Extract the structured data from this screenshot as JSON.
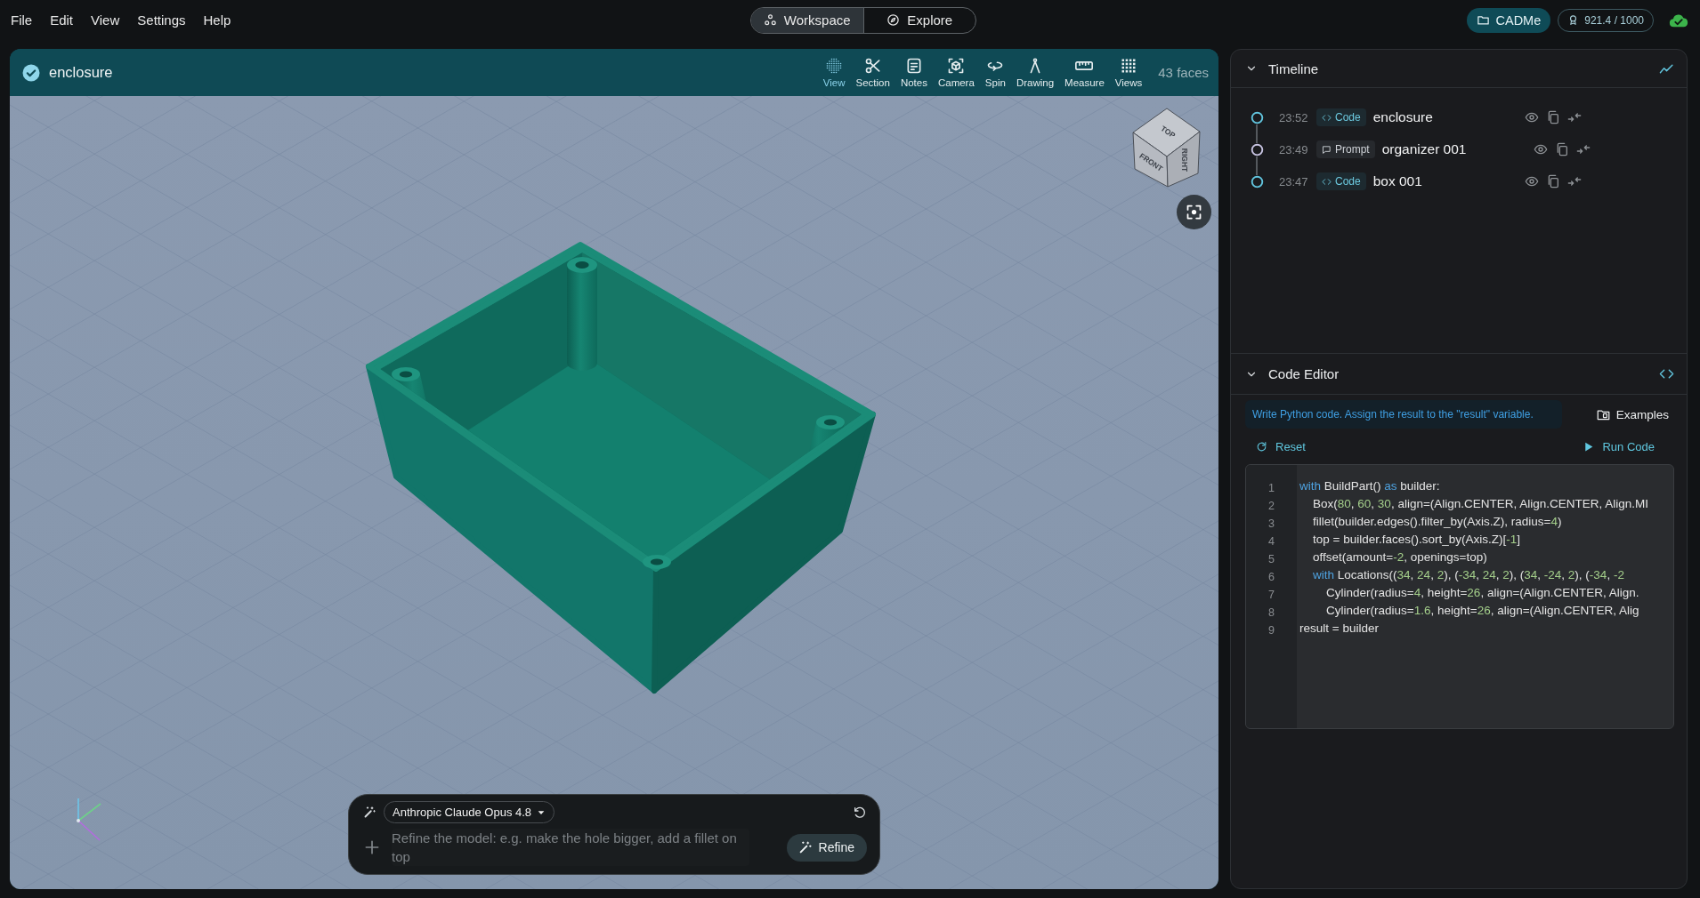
{
  "menu_bar": {
    "items": [
      "File",
      "Edit",
      "View",
      "Settings",
      "Help"
    ]
  },
  "mode_switch": [
    {
      "label": "Workspace",
      "kind": "workspace",
      "selected": true
    },
    {
      "label": "Explore",
      "kind": "explore",
      "selected": false
    }
  ],
  "account": {
    "project_button": "CADMe",
    "credits": "921.4 / 1000",
    "synced": true
  },
  "viewport": {
    "title": "enclosure",
    "tools": [
      {
        "label": "View",
        "kind": "view",
        "selected": true
      },
      {
        "label": "Section",
        "kind": "section",
        "selected": false
      },
      {
        "label": "Notes",
        "kind": "notes",
        "selected": false
      },
      {
        "label": "Camera",
        "kind": "camera",
        "selected": false
      },
      {
        "label": "Spin",
        "kind": "spin",
        "selected": false
      },
      {
        "label": "Drawing",
        "kind": "drawing",
        "selected": false
      },
      {
        "label": "Measure",
        "kind": "measure",
        "selected": false
      },
      {
        "label": "Views",
        "kind": "views",
        "selected": false
      }
    ],
    "face_count": "43 faces",
    "view_cube": [
      {
        "label": "TOP",
        "kind": "top"
      },
      {
        "label": "FRONT",
        "kind": "front"
      },
      {
        "label": "RIGHT",
        "kind": "right"
      }
    ]
  },
  "prompt": {
    "model": "Anthropic Claude Opus 4.8",
    "placeholder": "Refine the model: e.g. make the hole bigger, add a fillet on top",
    "button": "Refine"
  },
  "timeline": {
    "title": "Timeline",
    "expanded": true,
    "items": [
      {
        "time": "23:52",
        "kind": "code",
        "badge": "Code",
        "name": "enclosure"
      },
      {
        "time": "23:49",
        "kind": "prompt",
        "badge": "Prompt",
        "name": "organizer 001"
      },
      {
        "time": "23:47",
        "kind": "code",
        "badge": "Code",
        "name": "box 001"
      }
    ]
  },
  "code_editor": {
    "title": "Code Editor",
    "expanded": true,
    "hint": "Write Python code. Assign the result to the \"result\" variable.",
    "examples_button": "Examples",
    "reset_button": "Reset",
    "run_button": "Run Code",
    "lines": [
      {
        "number": "1",
        "tokens": [
          {
            "text": "with",
            "kind": "keyword"
          },
          {
            "text": " BuildPart() ",
            "kind": "plain"
          },
          {
            "text": "as",
            "kind": "keyword"
          },
          {
            "text": " builder:",
            "kind": "plain"
          }
        ]
      },
      {
        "number": "2",
        "tokens": [
          {
            "text": "    Box(",
            "kind": "plain"
          },
          {
            "text": "80",
            "kind": "number"
          },
          {
            "text": ", ",
            "kind": "plain"
          },
          {
            "text": "60",
            "kind": "number"
          },
          {
            "text": ", ",
            "kind": "plain"
          },
          {
            "text": "30",
            "kind": "number"
          },
          {
            "text": ", align=(Align.CENTER, Align.CENTER, Align.MI",
            "kind": "plain"
          }
        ]
      },
      {
        "number": "3",
        "tokens": [
          {
            "text": "    fillet(builder.edges().filter_by(Axis.Z), radius=",
            "kind": "plain"
          },
          {
            "text": "4",
            "kind": "number"
          },
          {
            "text": ")",
            "kind": "plain"
          }
        ]
      },
      {
        "number": "4",
        "tokens": [
          {
            "text": "    top = builder.faces().sort_by(Axis.Z)[",
            "kind": "plain"
          },
          {
            "text": "-1",
            "kind": "number"
          },
          {
            "text": "]",
            "kind": "plain"
          }
        ]
      },
      {
        "number": "5",
        "tokens": [
          {
            "text": "    offset(amount=",
            "kind": "plain"
          },
          {
            "text": "-2",
            "kind": "number"
          },
          {
            "text": ", openings=top)",
            "kind": "plain"
          }
        ]
      },
      {
        "number": "6",
        "tokens": [
          {
            "text": "    with",
            "kind": "keyword"
          },
          {
            "text": " Locations((",
            "kind": "plain"
          },
          {
            "text": "34",
            "kind": "number"
          },
          {
            "text": ", ",
            "kind": "plain"
          },
          {
            "text": "24",
            "kind": "number"
          },
          {
            "text": ", ",
            "kind": "plain"
          },
          {
            "text": "2",
            "kind": "number"
          },
          {
            "text": "), (",
            "kind": "plain"
          },
          {
            "text": "-34",
            "kind": "number"
          },
          {
            "text": ", ",
            "kind": "plain"
          },
          {
            "text": "24",
            "kind": "number"
          },
          {
            "text": ", ",
            "kind": "plain"
          },
          {
            "text": "2",
            "kind": "number"
          },
          {
            "text": "), (",
            "kind": "plain"
          },
          {
            "text": "34",
            "kind": "number"
          },
          {
            "text": ", ",
            "kind": "plain"
          },
          {
            "text": "-24",
            "kind": "number"
          },
          {
            "text": ", ",
            "kind": "plain"
          },
          {
            "text": "2",
            "kind": "number"
          },
          {
            "text": "), (",
            "kind": "plain"
          },
          {
            "text": "-34",
            "kind": "number"
          },
          {
            "text": ", ",
            "kind": "plain"
          },
          {
            "text": "-2",
            "kind": "number"
          }
        ]
      },
      {
        "number": "7",
        "tokens": [
          {
            "text": "        Cylinder(radius=",
            "kind": "plain"
          },
          {
            "text": "4",
            "kind": "number"
          },
          {
            "text": ", height=",
            "kind": "plain"
          },
          {
            "text": "26",
            "kind": "number"
          },
          {
            "text": ", align=(Align.CENTER, Align.",
            "kind": "plain"
          }
        ]
      },
      {
        "number": "8",
        "tokens": [
          {
            "text": "        Cylinder(radius=",
            "kind": "plain"
          },
          {
            "text": "1.6",
            "kind": "number"
          },
          {
            "text": ", height=",
            "kind": "plain"
          },
          {
            "text": "26",
            "kind": "number"
          },
          {
            "text": ", align=(Align.CENTER, Alig",
            "kind": "plain"
          }
        ]
      },
      {
        "number": "9",
        "tokens": [
          {
            "text": "result = builder",
            "kind": "plain"
          }
        ]
      }
    ]
  }
}
